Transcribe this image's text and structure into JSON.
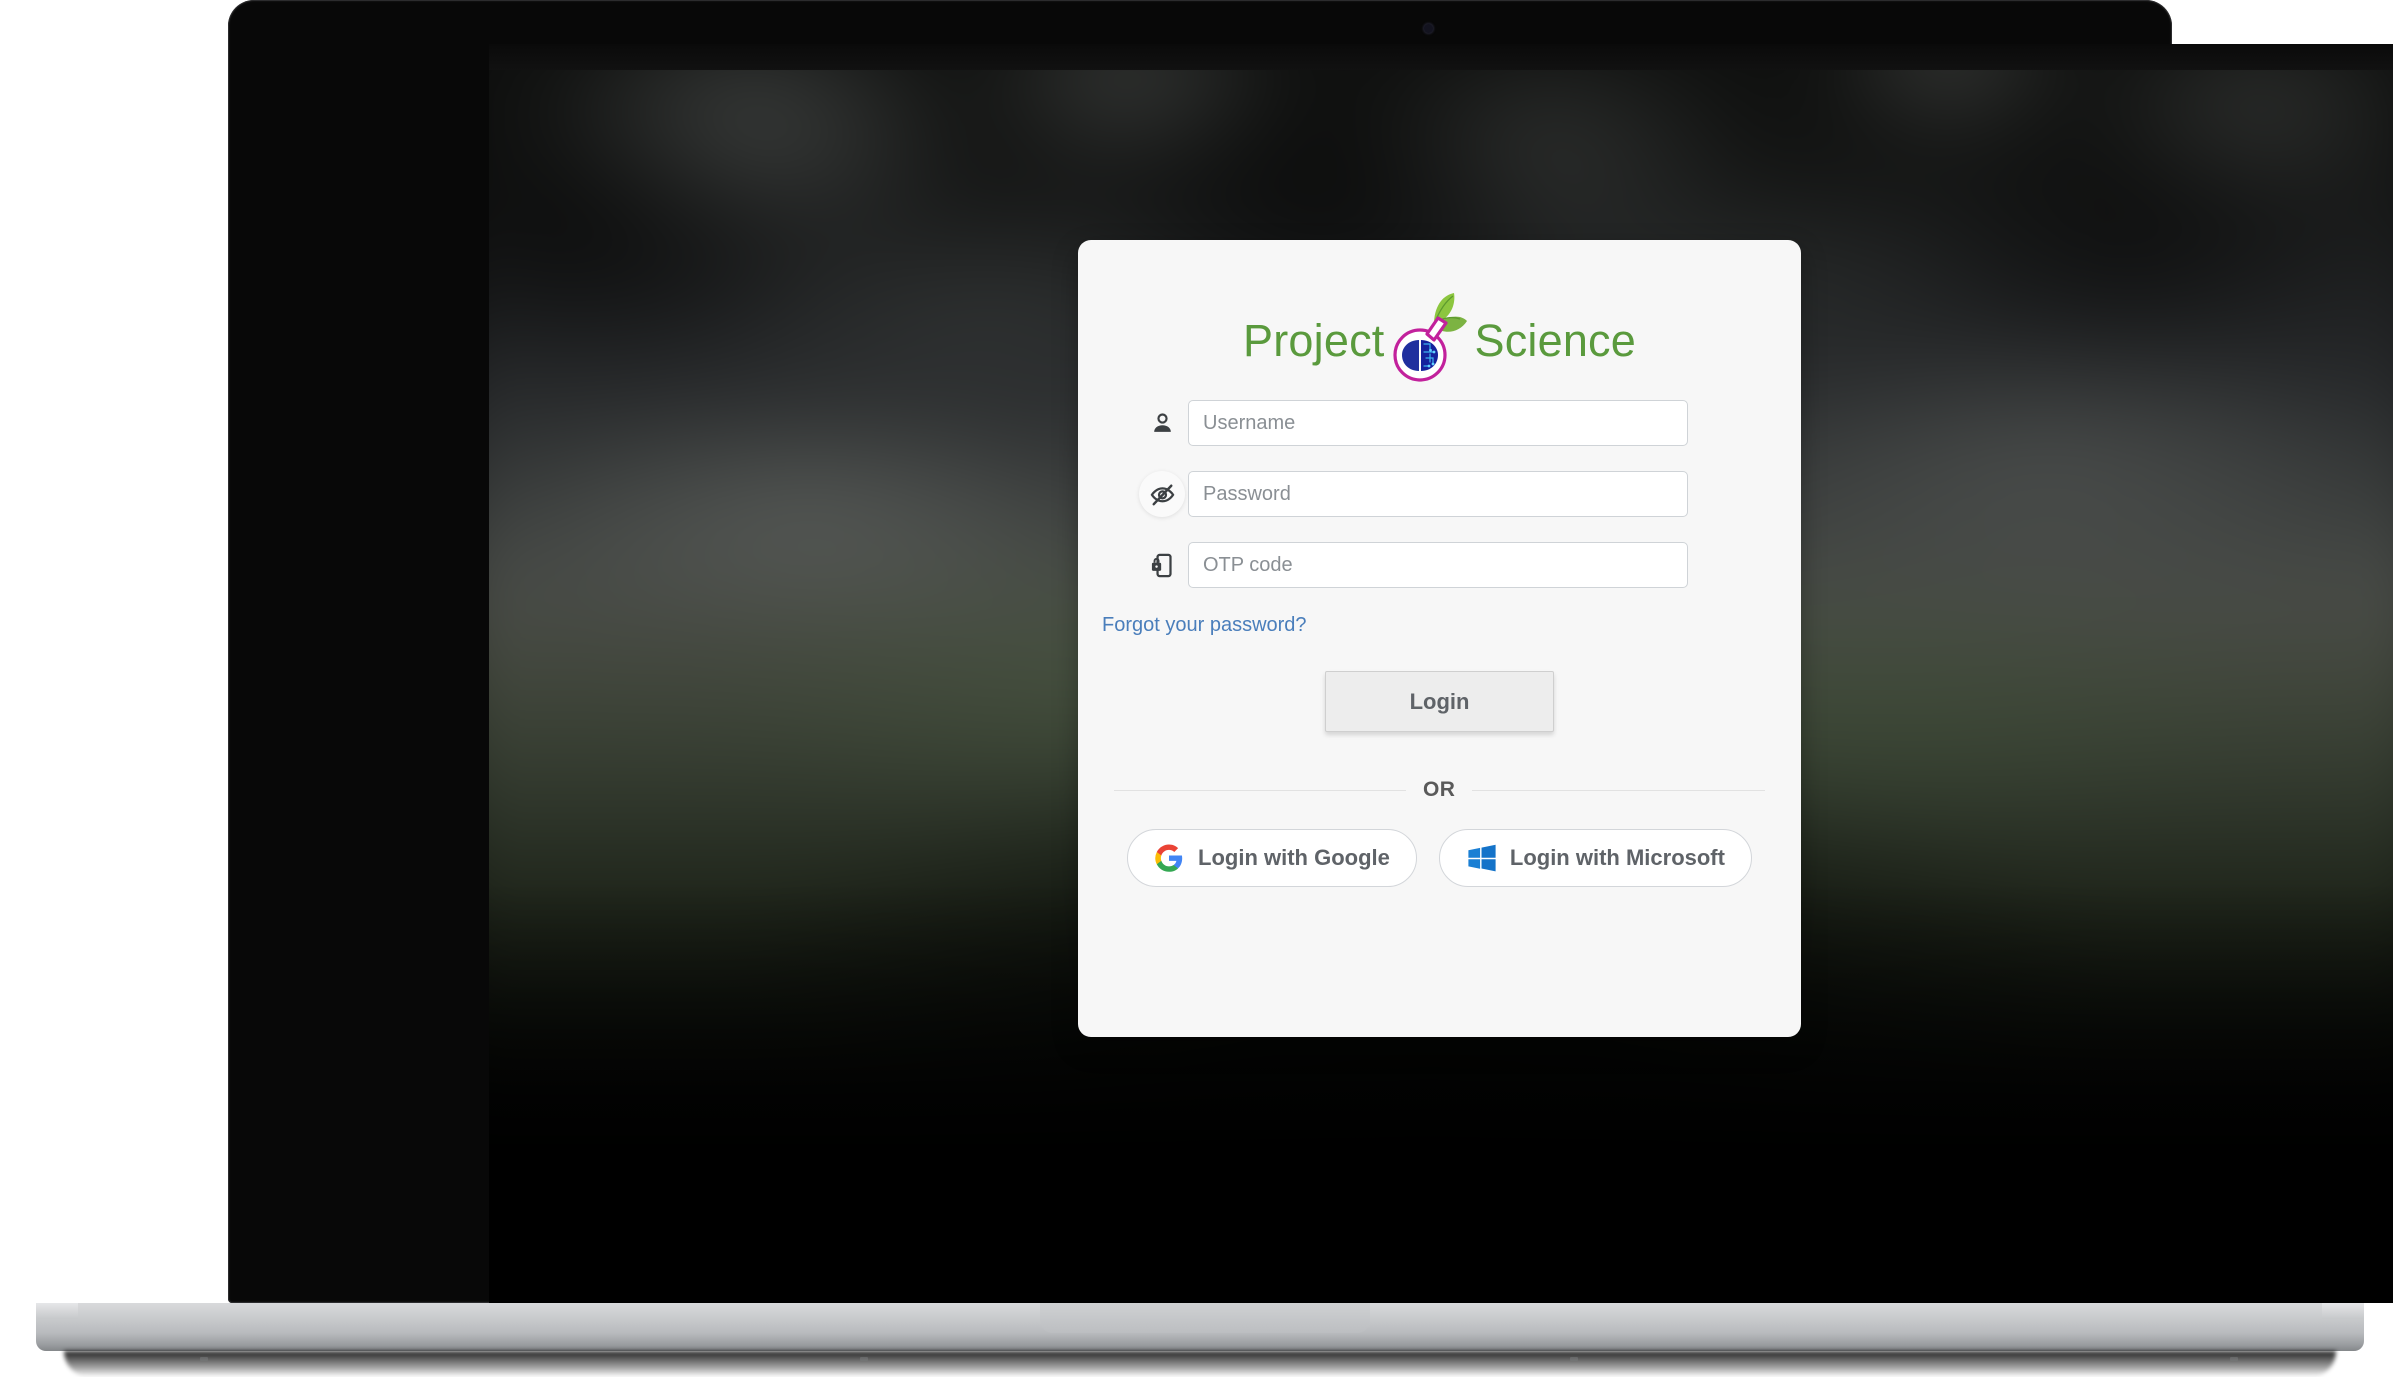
{
  "device": {
    "type": "laptop-mockup",
    "camera_icon": "camera-dot"
  },
  "brand": {
    "word_left": "Project",
    "word_right": "Science",
    "logo_icon": "flask-brain-leaf-logo",
    "color_text": "#5a9a3d",
    "color_flask_outline": "#c2219c",
    "color_brain": "#1f2f9e",
    "color_leaf": "#7cbb3f"
  },
  "form": {
    "fields": [
      {
        "name": "username",
        "icon": "person-icon",
        "placeholder": "Username",
        "value": ""
      },
      {
        "name": "password",
        "icon": "eye-off-icon",
        "placeholder": "Password",
        "value": ""
      },
      {
        "name": "otp",
        "icon": "phone-lock-icon",
        "placeholder": "OTP code",
        "value": ""
      }
    ],
    "forgot_password_label": "Forgot your password?",
    "forgot_password_color": "#4a7ebb",
    "login_button_label": "Login"
  },
  "divider": {
    "label": "OR"
  },
  "social": {
    "buttons": [
      {
        "name": "google",
        "label": "Login with Google",
        "icon": "google-g-icon"
      },
      {
        "name": "microsoft",
        "label": "Login with Microsoft",
        "icon": "microsoft-window-icon"
      }
    ]
  }
}
